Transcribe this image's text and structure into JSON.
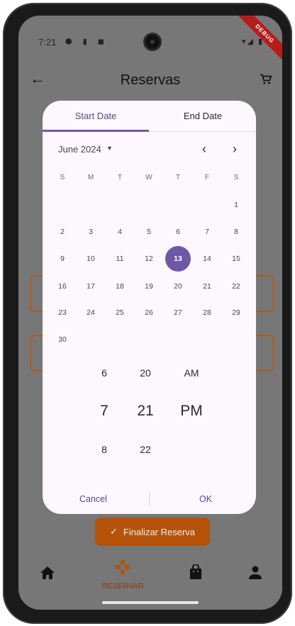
{
  "status": {
    "time": "7:21",
    "debug_banner": "DEBUG"
  },
  "appbar": {
    "title": "Reservas"
  },
  "background": {
    "finalize_button": "Finalizar Reserva"
  },
  "bottom_nav": {
    "items": [
      {
        "label": "",
        "icon": "home-icon"
      },
      {
        "label": "RESERVAR",
        "icon": "gamepad-icon"
      },
      {
        "label": "",
        "icon": "bag-icon"
      },
      {
        "label": "",
        "icon": "person-icon"
      }
    ]
  },
  "dialog": {
    "tabs": [
      {
        "label": "Start Date",
        "active": true
      },
      {
        "label": "End Date",
        "active": false
      }
    ],
    "month_label": "June 2024",
    "weekdays": [
      "S",
      "M",
      "T",
      "W",
      "T",
      "F",
      "S"
    ],
    "selected_day": "13",
    "days": {
      "d1": "1",
      "d2": "2",
      "d3": "3",
      "d4": "4",
      "d5": "5",
      "d6": "6",
      "d7": "7",
      "d8": "8",
      "d9": "9",
      "d10": "10",
      "d11": "11",
      "d12": "12",
      "d13": "13",
      "d14": "14",
      "d15": "15",
      "d16": "16",
      "d17": "17",
      "d18": "18",
      "d19": "19",
      "d20": "20",
      "d21": "21",
      "d22": "22",
      "d23": "23",
      "d24": "24",
      "d25": "25",
      "d26": "26",
      "d27": "27",
      "d28": "28",
      "d29": "29",
      "d30": "30"
    },
    "time_picker": {
      "hour_prev": "6",
      "hour": "7",
      "hour_next": "8",
      "minute_prev": "20",
      "minute": "21",
      "minute_next": "22",
      "period_prev": "AM",
      "period": "PM"
    },
    "cancel_label": "Cancel",
    "ok_label": "OK"
  },
  "colors": {
    "accent": "#6e58a6",
    "brand_orange": "#b45309",
    "dialog_bg": "#fdf7fe"
  }
}
